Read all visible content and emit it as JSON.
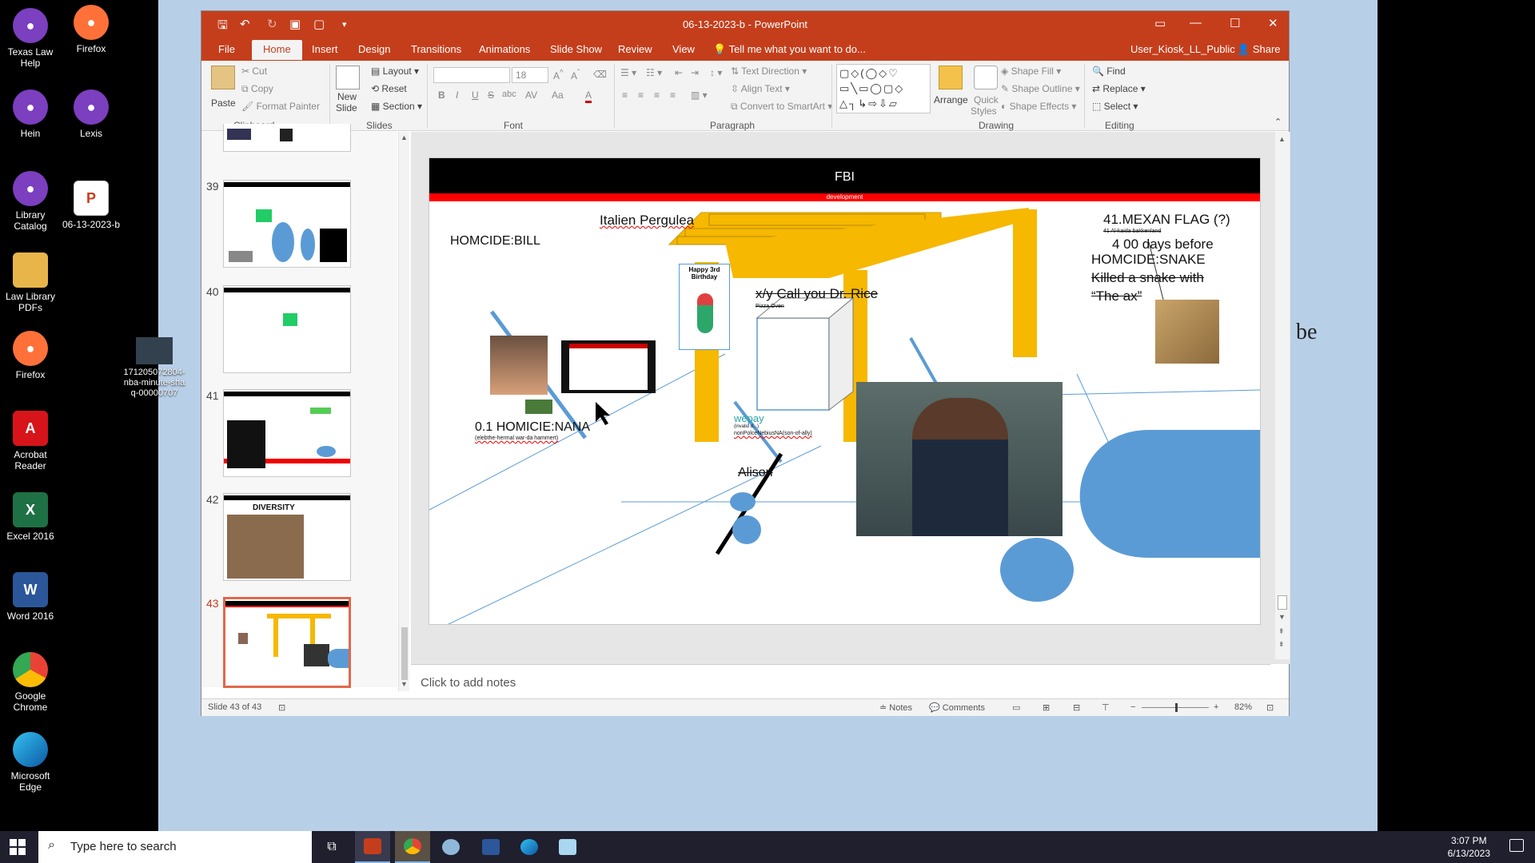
{
  "desktop": {
    "icons": [
      {
        "label": "Texas Law Help",
        "icon": "firefox-icon",
        "color": "#7b3fbf"
      },
      {
        "label": "Firefox",
        "icon": "firefox-icon",
        "color": "#ff7139"
      },
      {
        "label": "Hein",
        "icon": "firefox-icon",
        "color": "#7b3fbf"
      },
      {
        "label": "Lexis",
        "icon": "firefox-icon",
        "color": "#7b3fbf"
      },
      {
        "label": "Library Catalog",
        "icon": "firefox-icon",
        "color": "#7b3fbf"
      },
      {
        "label": "06-13-2023-b",
        "icon": "pptx-file-icon",
        "color": "#c43e1c"
      },
      {
        "label": "Law Library PDFs",
        "icon": "folder-icon",
        "color": "#e8b54a"
      },
      {
        "label": "Firefox",
        "icon": "firefox-icon",
        "color": "#ff7139"
      },
      {
        "label": "171205072804-nba-minute-shaq-00000707",
        "icon": "image-file-icon",
        "color": "#33414f"
      },
      {
        "label": "Acrobat Reader",
        "icon": "acrobat-icon",
        "color": "#d7141a"
      },
      {
        "label": "Excel 2016",
        "icon": "excel-icon",
        "color": "#1e7145"
      },
      {
        "label": "Word 2016",
        "icon": "word-icon",
        "color": "#2b579a"
      },
      {
        "label": "Google Chrome",
        "icon": "chrome-icon",
        "color": "#34a853"
      },
      {
        "label": "Microsoft Edge",
        "icon": "edge-icon",
        "color": "#0c7cd5"
      }
    ],
    "side_text": "be"
  },
  "window": {
    "title": "06-13-2023-b - PowerPoint",
    "tabs": [
      "File",
      "Home",
      "Insert",
      "Design",
      "Transitions",
      "Animations",
      "Slide Show",
      "Review",
      "View"
    ],
    "active_tab": "Home",
    "tell_me": "Tell me what you want to do...",
    "user": "User_Kiosk_LL_Public",
    "share": "Share"
  },
  "ribbon": {
    "clipboard": {
      "paste": "Paste",
      "cut": "Cut",
      "copy": "Copy",
      "format_painter": "Format Painter",
      "label": "Clipboard"
    },
    "slides": {
      "new_slide": "New",
      "new_slide2": "Slide",
      "layout": "Layout",
      "reset": "Reset",
      "section": "Section",
      "label": "Slides"
    },
    "font": {
      "size": "18",
      "label": "Font",
      "bold": "B",
      "italic": "I",
      "underline": "U",
      "strike": "S",
      "shadow": "abc",
      "spacing": "AV",
      "case": "Aa",
      "color": "A"
    },
    "paragraph": {
      "text_direction": "Text Direction",
      "align_text": "Align Text",
      "smartart": "Convert to SmartArt",
      "label": "Paragraph"
    },
    "drawing": {
      "arrange": "Arrange",
      "quick_styles": "Quick",
      "quick_styles2": "Styles",
      "shape_fill": "Shape Fill",
      "shape_outline": "Shape Outline",
      "shape_effects": "Shape Effects",
      "label": "Drawing"
    },
    "editing": {
      "find": "Find",
      "replace": "Replace",
      "select": "Select",
      "label": "Editing"
    }
  },
  "thumbnails": [
    {
      "number": "39"
    },
    {
      "number": "40"
    },
    {
      "number": "41"
    },
    {
      "number": "42",
      "caption": "DIVERSITY"
    },
    {
      "number": "43",
      "selected": true
    }
  ],
  "slide": {
    "header": "FBI",
    "subheader": "development",
    "texts": {
      "italien": "Italien Pergulea",
      "bill": "HOMCIDE:BILL",
      "flag": "41.MEXAN FLAG (?)",
      "flag_small": "41 Al-kaida bakkenland",
      "days": "4 00 days before",
      "snake": "HOMCIDE:SNAKE",
      "killed": "Killed a snake with",
      "ax": "“The ax”",
      "birthday": "Happy 3rd Birthday",
      "callyou": "x/y Call you Dr. Rice",
      "pizza": "Pizza Oven",
      "nana": "0.1 HOMICIE:NANA",
      "nana_small": "(elebthe-hermal war-da hammert)",
      "wepay": "wepay",
      "wepay_small": "(invalid d...)",
      "nonpolice": "nonPolceNebiusNA(son-of-ally)",
      "alison": "Alison"
    }
  },
  "notes": "Click to add notes",
  "status": {
    "slide_of": "Slide 43 of 43",
    "notes": "Notes",
    "comments": "Comments",
    "zoom": "82%"
  },
  "taskbar": {
    "search_placeholder": "Type here to search",
    "time": "3:07 PM",
    "date": "6/13/2023"
  }
}
